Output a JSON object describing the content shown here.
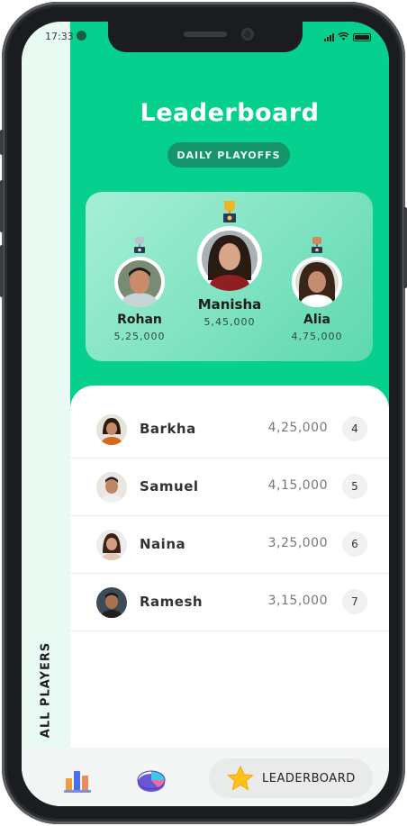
{
  "status": {
    "time": "17:33"
  },
  "header": {
    "title": "Leaderboard",
    "filter_label": "DAILY PLAYOFFS"
  },
  "sidebar": {
    "label": "ALL PLAYERS"
  },
  "top_three": [
    {
      "rank": 2,
      "name": "Rohan",
      "score": "5,25,000",
      "trophy": "silver-trophy-icon"
    },
    {
      "rank": 1,
      "name": "Manisha",
      "score": "5,45,000",
      "trophy": "gold-trophy-icon"
    },
    {
      "rank": 3,
      "name": "Alia",
      "score": "4,75,000",
      "trophy": "bronze-trophy-icon"
    }
  ],
  "players": [
    {
      "name": "Barkha",
      "score": "4,25,000",
      "rank": "4"
    },
    {
      "name": "Samuel",
      "score": "4,15,000",
      "rank": "5"
    },
    {
      "name": "Naina",
      "score": "3,25,000",
      "rank": "6"
    },
    {
      "name": "Ramesh",
      "score": "3,15,000",
      "rank": "7"
    }
  ],
  "bottom_nav": {
    "active_label": "LEADERBOARD",
    "active_icon": "star-icon"
  },
  "colors": {
    "accent": "#05d08d",
    "pill": "#14946a",
    "strip": "#e9faf3"
  }
}
